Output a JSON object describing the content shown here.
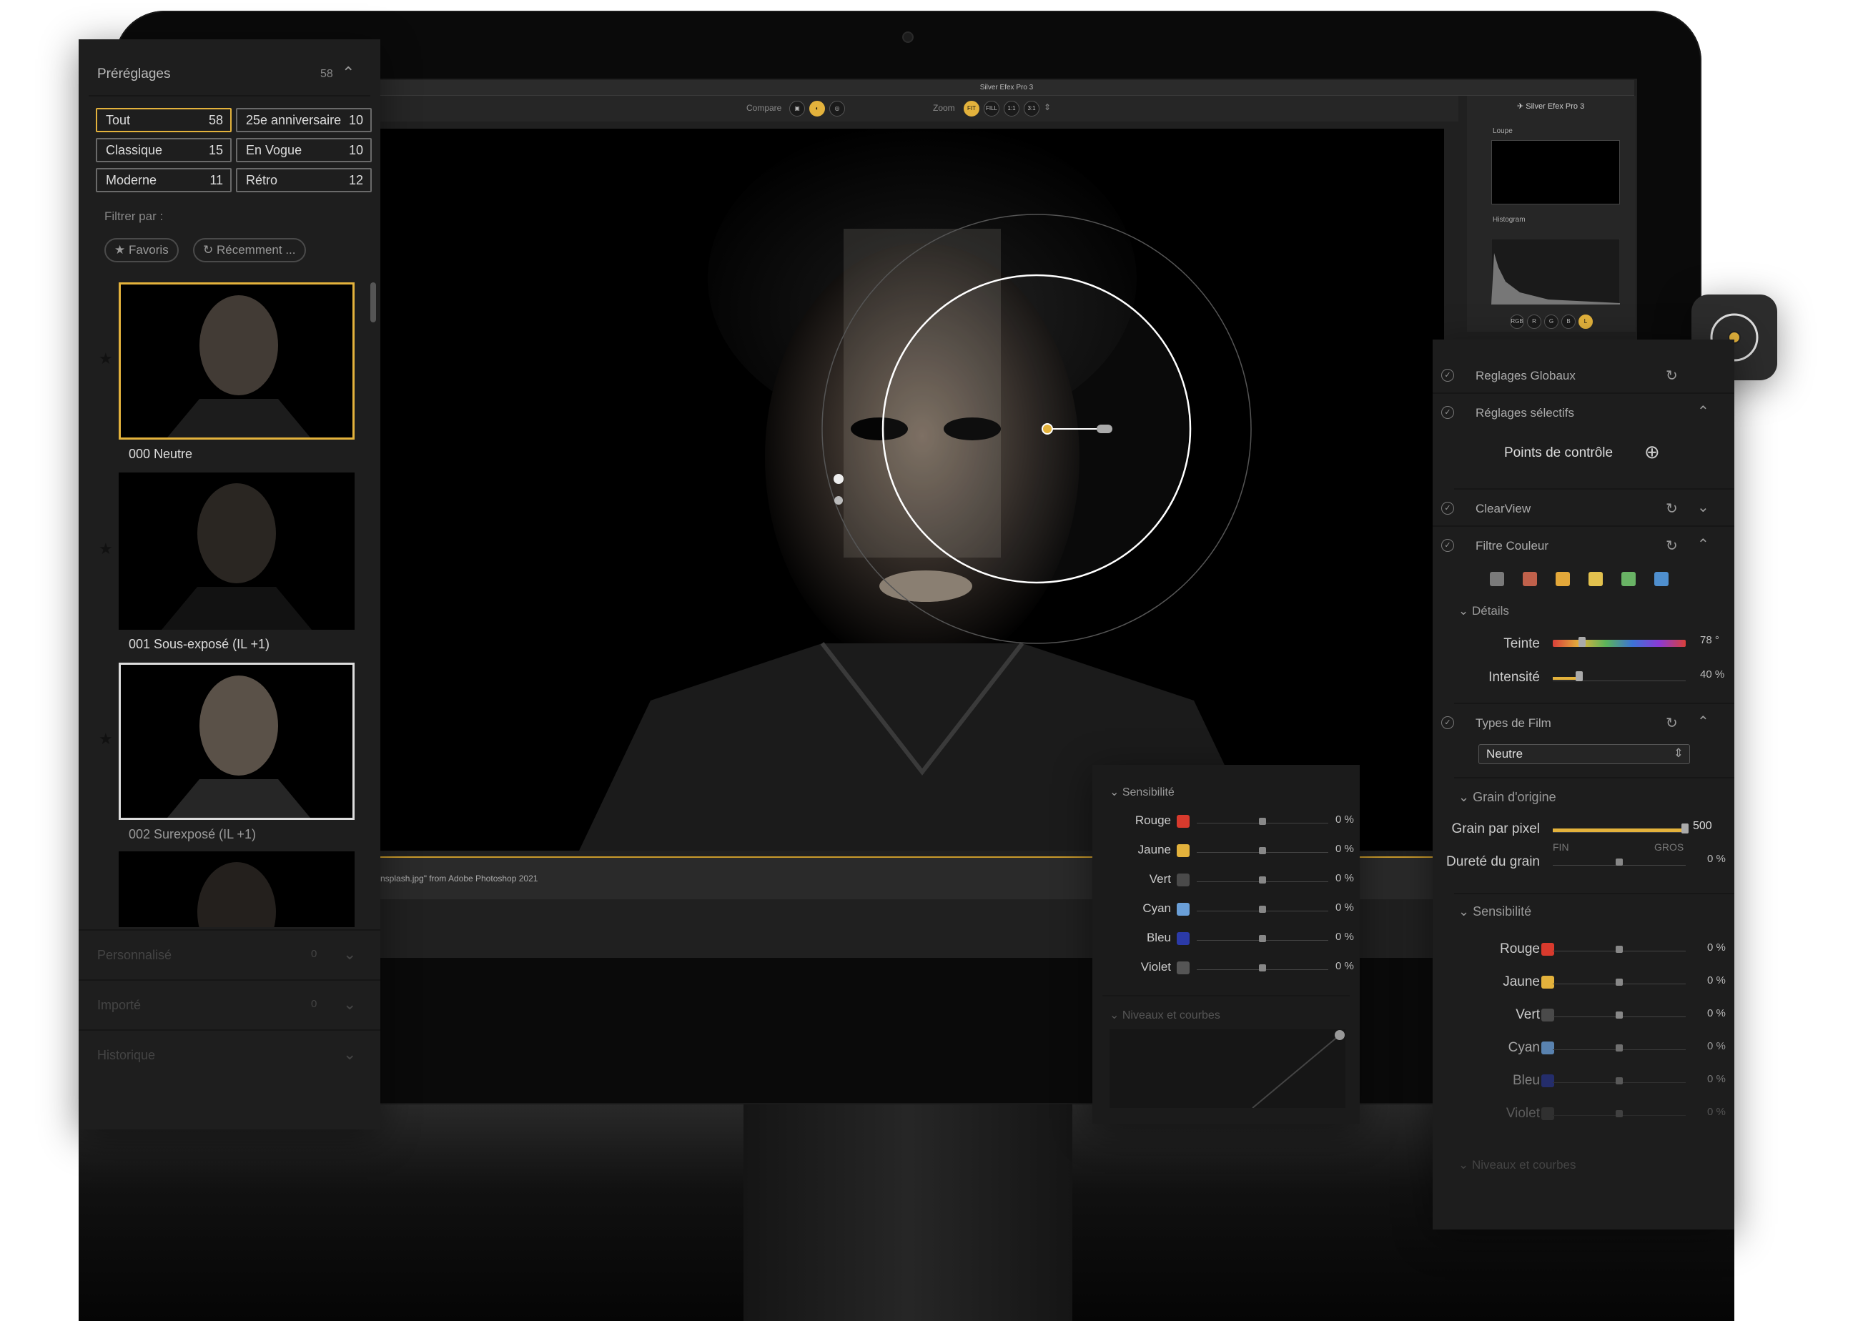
{
  "window": {
    "title": "Silver Efex Pro 3",
    "brand": "Silver Efex Pro 3"
  },
  "toolbar": {
    "compare_label": "Compare",
    "zoom_label": "Zoom",
    "zoom_fit": "FIT",
    "zoom_fill": "FILL",
    "zoom_1_1": "1:1",
    "zoom_3_1": "3:1"
  },
  "status": {
    "file_text": "nsplash.jpg\" from Adobe Photoshop 2021"
  },
  "right_column": {
    "loupe_label": "Loupe",
    "histogram_label": "Histogram",
    "channels": [
      "RGB",
      "R",
      "G",
      "B",
      "L"
    ]
  },
  "presets": {
    "title": "Préréglages",
    "count": "58",
    "categories": [
      {
        "name": "Tout",
        "count": "58",
        "active": true
      },
      {
        "name": "25e anniversaire",
        "count": "10"
      },
      {
        "name": "Classique",
        "count": "15"
      },
      {
        "name": "En Vogue",
        "count": "10"
      },
      {
        "name": "Moderne",
        "count": "11"
      },
      {
        "name": "Rétro",
        "count": "12"
      }
    ],
    "filter_label": "Filtrer par :",
    "filters": [
      "★ Favoris",
      "↻ Récemment ..."
    ],
    "thumbnails": [
      {
        "label": "000 Neutre"
      },
      {
        "label": "001 Sous-exposé (IL +1)"
      },
      {
        "label": "002 Surexposé (IL +1)"
      }
    ],
    "sections": [
      {
        "label": "Personnalisé",
        "count": "0"
      },
      {
        "label": "Importé",
        "count": "0"
      },
      {
        "label": "Historique"
      }
    ]
  },
  "adjust": {
    "global_label": "Reglages Globaux",
    "selective_label": "Réglages sélectifs",
    "control_points_label": "Points de contrôle",
    "clearview_label": "ClearView",
    "color_filter_label": "Filtre Couleur",
    "color_filter_swatches": [
      "#7a7a7a",
      "#c0614b",
      "#e3a83a",
      "#e2c14e",
      "#69b365",
      "#4f8fce"
    ],
    "details_label": "Détails",
    "tint_label": "Teinte",
    "tint_value": "78 °",
    "tint_pos": 0.22,
    "intensity_label": "Intensité",
    "intensity_value": "40 %",
    "intensity_pos": 0.2,
    "film_types_label": "Types de Film",
    "film_select": "Neutre",
    "grain_label": "Grain d'origine",
    "grain_per_pixel_label": "Grain par pixel",
    "grain_per_pixel_value": "500",
    "grain_fin": "FIN",
    "grain_gros": "GROS",
    "grain_hardness_label": "Dureté du grain",
    "grain_hardness_value": "0 %",
    "sensitivity_label": "Sensibilité",
    "channels": [
      {
        "name": "Rouge",
        "color": "#d83a2d",
        "value": "0 %"
      },
      {
        "name": "Jaune",
        "color": "#e3b23c",
        "value": "0 %"
      },
      {
        "name": "Vert",
        "color": "#4a4a4a",
        "value": "0 %"
      },
      {
        "name": "Cyan",
        "color": "#6a9fd8",
        "value": "0 %"
      },
      {
        "name": "Bleu",
        "color": "#2b3aa8",
        "value": "0 %"
      },
      {
        "name": "Violet",
        "color": "#555555",
        "value": "0 %"
      }
    ],
    "levels_label": "Niveaux et courbes"
  },
  "sensitivity_panel": {
    "title": "Sensibilité",
    "channels": [
      {
        "name": "Rouge",
        "color": "#d83a2d",
        "value": "0 %"
      },
      {
        "name": "Jaune",
        "color": "#e3b23c",
        "value": "0 %"
      },
      {
        "name": "Vert",
        "color": "#4a4a4a",
        "value": "0 %"
      },
      {
        "name": "Cyan",
        "color": "#6a9fd8",
        "value": "0 %"
      },
      {
        "name": "Bleu",
        "color": "#2b3aa8",
        "value": "0 %"
      },
      {
        "name": "Violet",
        "color": "#555555",
        "value": "0 %"
      }
    ],
    "levels_label": "Niveaux et courbes"
  },
  "colors": {
    "accent": "#e3b23c"
  }
}
